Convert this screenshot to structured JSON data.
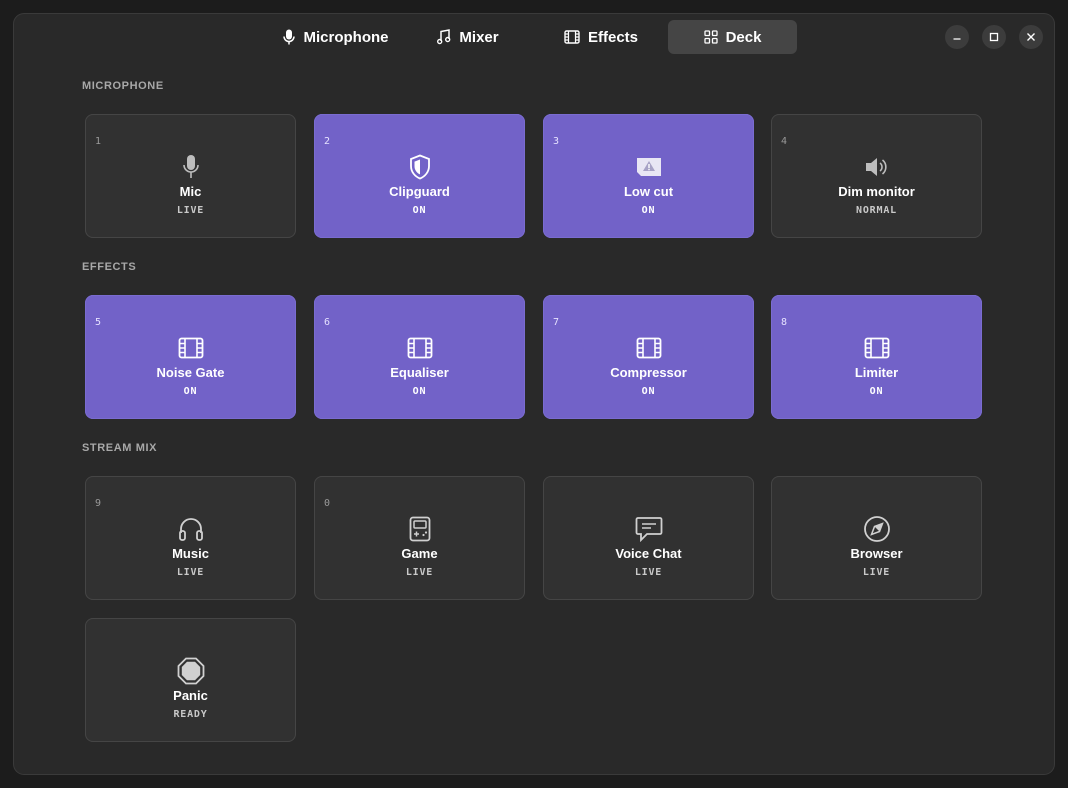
{
  "tabs": [
    {
      "label": "Microphone",
      "icon": "microphone-icon",
      "active": false
    },
    {
      "label": "Mixer",
      "icon": "music-note-icon",
      "active": false
    },
    {
      "label": "Effects",
      "icon": "film-icon",
      "active": false
    },
    {
      "label": "Deck",
      "icon": "grid-icon",
      "active": true
    }
  ],
  "window_controls": [
    "minimize-icon",
    "maximize-icon",
    "close-icon"
  ],
  "sections": [
    {
      "title": "MICROPHONE",
      "cards": [
        {
          "num": "1",
          "label": "Mic",
          "status": "LIVE",
          "icon": "microphone-icon",
          "on": false
        },
        {
          "num": "2",
          "label": "Clipguard",
          "status": "ON",
          "icon": "shield-icon",
          "on": true
        },
        {
          "num": "3",
          "label": "Low cut",
          "status": "ON",
          "icon": "warning-icon",
          "on": true
        },
        {
          "num": "4",
          "label": "Dim monitor",
          "status": "NORMAL",
          "icon": "speaker-icon",
          "on": false
        }
      ]
    },
    {
      "title": "EFFECTS",
      "cards": [
        {
          "num": "5",
          "label": "Noise Gate",
          "status": "ON",
          "icon": "film-icon",
          "on": true
        },
        {
          "num": "6",
          "label": "Equaliser",
          "status": "ON",
          "icon": "film-icon",
          "on": true
        },
        {
          "num": "7",
          "label": "Compressor",
          "status": "ON",
          "icon": "film-icon",
          "on": true
        },
        {
          "num": "8",
          "label": "Limiter",
          "status": "ON",
          "icon": "film-icon",
          "on": true
        }
      ]
    },
    {
      "title": "STREAM MIX",
      "cards": [
        {
          "num": "9",
          "label": "Music",
          "status": "LIVE",
          "icon": "headphones-icon",
          "on": false
        },
        {
          "num": "0",
          "label": "Game",
          "status": "LIVE",
          "icon": "gamepad-icon",
          "on": false
        },
        {
          "num": "",
          "label": "Voice Chat",
          "status": "LIVE",
          "icon": "chat-icon",
          "on": false
        },
        {
          "num": "",
          "label": "Browser",
          "status": "LIVE",
          "icon": "compass-icon",
          "on": false
        },
        {
          "num": "",
          "label": "Panic",
          "status": "READY",
          "icon": "stop-icon",
          "on": false
        }
      ]
    }
  ],
  "colors": {
    "accent": "#7262c8",
    "card": "#313131",
    "window": "#292929"
  }
}
